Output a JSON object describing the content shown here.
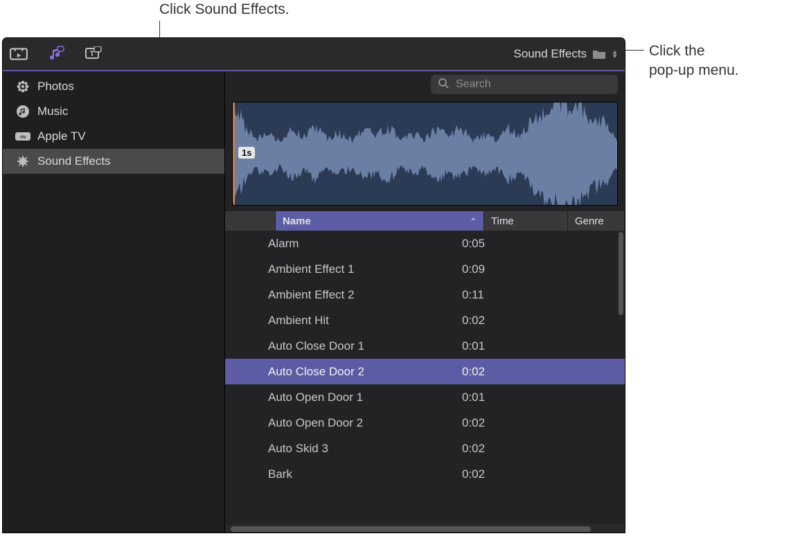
{
  "callouts": {
    "top": "Click Sound Effects.",
    "right_line1": "Click the",
    "right_line2": "pop-up menu."
  },
  "toolbar": {
    "popup_label": "Sound Effects"
  },
  "search": {
    "placeholder": "Search"
  },
  "sidebar": {
    "items": [
      {
        "label": "Photos",
        "icon": "flower-icon",
        "selected": false
      },
      {
        "label": "Music",
        "icon": "music-icon",
        "selected": false
      },
      {
        "label": "Apple TV",
        "icon": "appletv-icon",
        "selected": false
      },
      {
        "label": "Sound Effects",
        "icon": "burst-icon",
        "selected": true
      }
    ]
  },
  "waveform": {
    "time_label": "1s"
  },
  "columns": {
    "name": "Name",
    "time": "Time",
    "genre": "Genre"
  },
  "rows": [
    {
      "name": "Alarm",
      "time": "0:05",
      "genre": "",
      "selected": false
    },
    {
      "name": "Ambient Effect 1",
      "time": "0:09",
      "genre": "",
      "selected": false
    },
    {
      "name": "Ambient Effect 2",
      "time": "0:11",
      "genre": "",
      "selected": false
    },
    {
      "name": "Ambient Hit",
      "time": "0:02",
      "genre": "",
      "selected": false
    },
    {
      "name": "Auto Close Door 1",
      "time": "0:01",
      "genre": "",
      "selected": false
    },
    {
      "name": "Auto Close Door 2",
      "time": "0:02",
      "genre": "",
      "selected": true
    },
    {
      "name": "Auto Open Door 1",
      "time": "0:01",
      "genre": "",
      "selected": false
    },
    {
      "name": "Auto Open Door 2",
      "time": "0:02",
      "genre": "",
      "selected": false
    },
    {
      "name": "Auto Skid 3",
      "time": "0:02",
      "genre": "",
      "selected": false
    },
    {
      "name": "Bark",
      "time": "0:02",
      "genre": "",
      "selected": false
    }
  ]
}
